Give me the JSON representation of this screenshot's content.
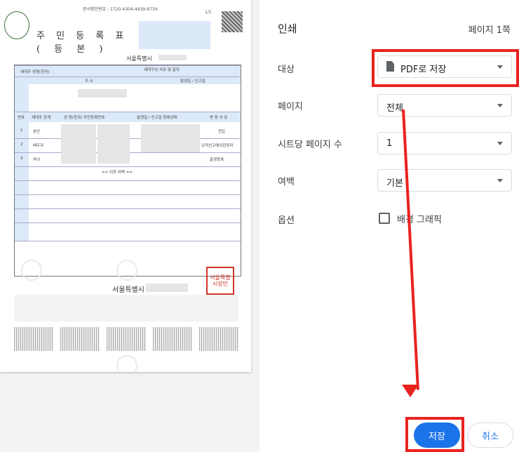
{
  "preview": {
    "doc_number_label": "문서확인번호 : 1720-4304-4439-6734",
    "page_fraction": "1/1",
    "title": "주 민 등 록 표",
    "subtitle": "( 등      본 )",
    "issuer_top": "서울특별시",
    "issuer_bottom": "서울특별시",
    "table_headers": {
      "head_name": "세대주 성명(한자)",
      "relation": "세대구성 사유 및 일자",
      "address": "주            소",
      "date": "발생일 / 신고일",
      "change": "변 동 사 유",
      "no": "번호",
      "member": "세대주 관계",
      "member_name": "성 명(한자) 주민등록번호",
      "move_date": "발생일 / 신고일 등록상태",
      "move_reason": "변 동 사 유"
    },
    "rows": [
      {
        "no": "1",
        "rel": "본인",
        "reason": "전입"
      },
      {
        "no": "2",
        "rel": "배우자",
        "reason": "오적신고에의한정리"
      },
      {
        "no": "3",
        "rel": "자녀",
        "reason": "출생등록"
      }
    ],
    "end_marker": "== 이하 여백 ==",
    "stamp_text": "서울특별시장인"
  },
  "print": {
    "title": "인쇄",
    "page_count": "페이지 1쪽",
    "destination_label": "대상",
    "destination_value": "PDF로 저장",
    "pages_label": "페이지",
    "pages_value": "전체",
    "pages_per_sheet_label": "시트당 페이지 수",
    "pages_per_sheet_value": "1",
    "margins_label": "여백",
    "margins_value": "기본",
    "options_label": "옵션",
    "background_graphics_label": "배경 그래픽",
    "save_label": "저장",
    "cancel_label": "취소"
  },
  "colors": {
    "accent": "#1a73e8",
    "annotation": "#e8231f"
  }
}
